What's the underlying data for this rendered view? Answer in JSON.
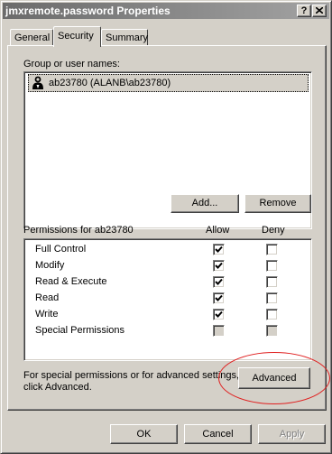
{
  "window": {
    "title": "jmxremote.password Properties",
    "help_btn": "?",
    "close_btn": "X"
  },
  "tabs": [
    {
      "label": "General",
      "active": false
    },
    {
      "label": "Security",
      "active": true
    },
    {
      "label": "Summary",
      "active": false
    }
  ],
  "security": {
    "group_label": "Group or user names:",
    "users": [
      {
        "name": "ab23780 (ALANB\\ab23780)",
        "icon": "user-icon"
      }
    ],
    "add_label": "Add...",
    "remove_label": "Remove",
    "permissions_label": "Permissions for ab23780",
    "allow_header": "Allow",
    "deny_header": "Deny",
    "permissions": [
      {
        "name": "Full Control",
        "allow": true,
        "deny": false
      },
      {
        "name": "Modify",
        "allow": true,
        "deny": false
      },
      {
        "name": "Read & Execute",
        "allow": true,
        "deny": false
      },
      {
        "name": "Read",
        "allow": true,
        "deny": false
      },
      {
        "name": "Write",
        "allow": true,
        "deny": false
      },
      {
        "name": "Special Permissions",
        "allow": false,
        "deny": false,
        "disabled": true
      }
    ],
    "advanced_text_line1": "For special permissions or for advanced settings,",
    "advanced_text_line2": "click Advanced.",
    "advanced_label": "Advanced"
  },
  "footer": {
    "ok_label": "OK",
    "cancel_label": "Cancel",
    "apply_label": "Apply"
  },
  "colors": {
    "highlight_oval": "#e02020",
    "face": "#d4d0c8"
  }
}
